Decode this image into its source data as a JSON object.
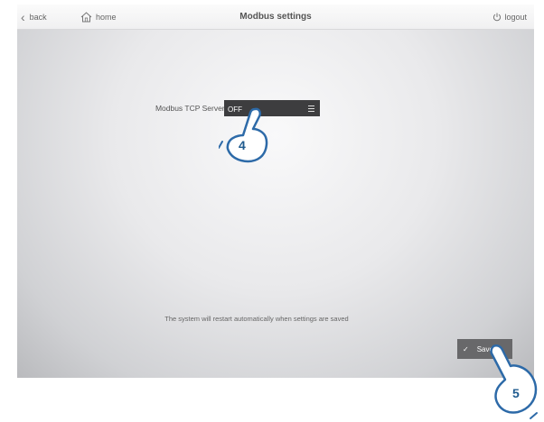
{
  "topbar": {
    "back_label": "back",
    "home_label": "home",
    "title": "Modbus settings",
    "logout_label": "logout"
  },
  "settings": {
    "modbus_tcp_label": "Modbus TCP Server:",
    "modbus_tcp_value": "OFF"
  },
  "footer": {
    "restart_note": "The system will restart automatically when settings are saved",
    "save_label": "Save",
    "save_check": "✓"
  },
  "annotations": {
    "step_select": "4",
    "step_save": "5",
    "callout_color": "#1f5b8f"
  }
}
